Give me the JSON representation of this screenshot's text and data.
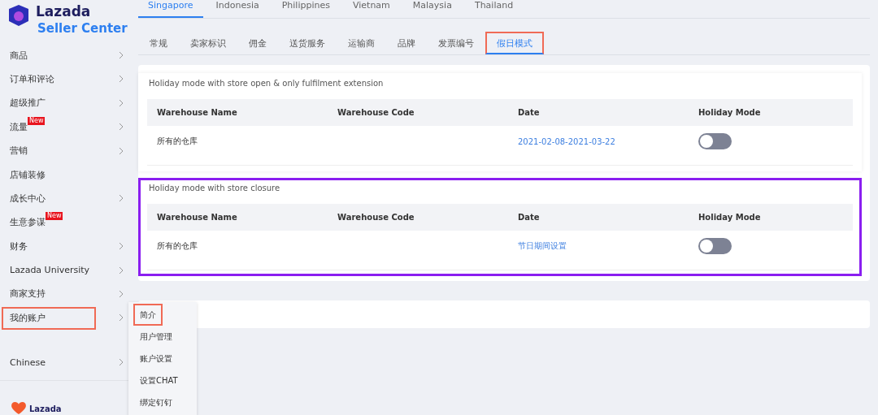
{
  "logo": {
    "brand": "Lazada",
    "product": "Seller Center"
  },
  "sidebar": {
    "items": [
      {
        "label": "商品",
        "arrow": true,
        "highlighted": false
      },
      {
        "label": "订单和评论",
        "arrow": true,
        "highlighted": false
      },
      {
        "label": "超级推广",
        "arrow": true,
        "highlighted": false
      },
      {
        "label": "流量",
        "badge": "New",
        "arrow": true,
        "highlighted": false
      },
      {
        "label": "营销",
        "arrow": true,
        "highlighted": false
      },
      {
        "label": "店铺装修",
        "arrow": false,
        "highlighted": false
      },
      {
        "label": "成长中心",
        "arrow": true,
        "highlighted": false
      },
      {
        "label": "生意参谋",
        "badge": "New",
        "arrow": false,
        "highlighted": false
      },
      {
        "label": "财务",
        "arrow": true,
        "highlighted": false
      },
      {
        "label": "Lazada University",
        "arrow": true,
        "highlighted": false
      },
      {
        "label": "商家支持",
        "arrow": true,
        "highlighted": false
      },
      {
        "label": "我的账户",
        "arrow": true,
        "highlighted": true
      }
    ],
    "language": "Chinese",
    "footer_brand": "Lazada"
  },
  "submenu": [
    {
      "label": "简介",
      "highlighted": true
    },
    {
      "label": "用户管理",
      "highlighted": false
    },
    {
      "label": "账户设置",
      "highlighted": false
    },
    {
      "label": "设置CHAT",
      "highlighted": false
    },
    {
      "label": "绑定钉钉",
      "highlighted": false
    }
  ],
  "country_tabs": [
    {
      "label": "Singapore",
      "selected": true
    },
    {
      "label": "Indonesia",
      "selected": false
    },
    {
      "label": "Philippines",
      "selected": false
    },
    {
      "label": "Vietnam",
      "selected": false
    },
    {
      "label": "Malaysia",
      "selected": false
    },
    {
      "label": "Thailand",
      "selected": false
    }
  ],
  "settings_tabs": [
    {
      "label": "常规",
      "selected": false,
      "highlighted": false
    },
    {
      "label": "卖家标识",
      "selected": false,
      "highlighted": false
    },
    {
      "label": "佣金",
      "selected": false,
      "highlighted": false
    },
    {
      "label": "送货服务",
      "selected": false,
      "highlighted": false
    },
    {
      "label": "运输商",
      "selected": false,
      "highlighted": false
    },
    {
      "label": "品牌",
      "selected": false,
      "highlighted": false
    },
    {
      "label": "发票编号",
      "selected": false,
      "highlighted": false
    },
    {
      "label": "假日模式",
      "selected": true,
      "highlighted": true
    }
  ],
  "sections": [
    {
      "title": "Holiday mode with store open & only fulfilment extension",
      "highlighted": false,
      "columns": [
        "Warehouse Name",
        "Warehouse Code",
        "Date",
        "Holiday Mode"
      ],
      "rows": [
        {
          "warehouse_name": "所有的仓库",
          "date": "2021-02-08-2021-03-22",
          "on": false
        }
      ]
    },
    {
      "title": "Holiday mode with store closure",
      "highlighted": true,
      "columns": [
        "Warehouse Name",
        "Warehouse Code",
        "Date",
        "Holiday Mode"
      ],
      "rows": [
        {
          "warehouse_name": "所有的仓库",
          "date": "节日期间设置",
          "on": false
        }
      ]
    }
  ]
}
